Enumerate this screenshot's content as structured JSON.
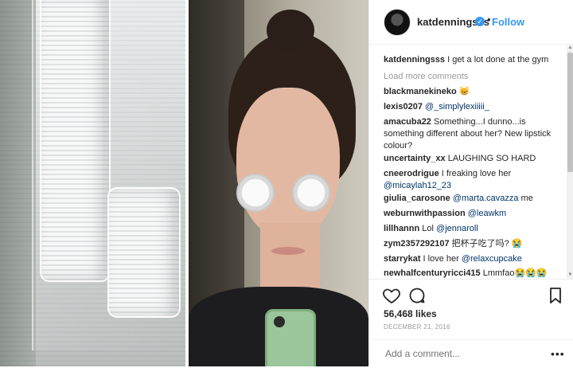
{
  "post": {
    "username": "katdenningsss",
    "verified_mark": "✓",
    "separator": "•",
    "follow_label": "Follow",
    "load_more": "Load more comments",
    "likes": "56,468 likes",
    "date": "DECEMBER 21, 2016",
    "add_comment_placeholder": "Add a comment...",
    "more_options": "•••"
  },
  "comments": [
    {
      "user": "katdenningsss",
      "text": " I get a lot done at the gym",
      "mention": ""
    },
    {
      "user": "blackmanekineko",
      "text": " 😸",
      "mention": ""
    },
    {
      "user": "lexis0207",
      "text": " ",
      "mention": "@_simplylexiiiii_"
    },
    {
      "user": "amacuba22",
      "text": " Something...I dunno...is something different about her? New lipstick colour?",
      "mention": ""
    },
    {
      "user": "uncertainty_xx",
      "text": " LAUGHING SO HARD",
      "mention": ""
    },
    {
      "user": "cneerodrigue",
      "text": " I freaking love her ",
      "mention": "@micaylah12_23"
    },
    {
      "user": "giulia_carosone",
      "text": " ",
      "mention": "@marta.cavazza",
      "after": " me"
    },
    {
      "user": "weburnwithpassion",
      "text": " ",
      "mention": "@leawkm"
    },
    {
      "user": "lillhannn",
      "text": " Lol ",
      "mention": "@jennaroll"
    },
    {
      "user": "zym2357292107",
      "text": " 把杯子吃了吗? 😭",
      "mention": ""
    },
    {
      "user": "starrykat",
      "text": " I love her ",
      "mention": "@relaxcupcake"
    },
    {
      "user": "newhalfcenturyricci415",
      "text": " Lmmfao😭😭😭",
      "mention": ""
    }
  ],
  "icons": {
    "heart": "heart-icon",
    "comment": "comment-icon",
    "bookmark": "bookmark-icon",
    "verified": "verified-badge-icon",
    "more": "more-options-icon"
  },
  "colors": {
    "accent": "#3897f0",
    "text": "#262626",
    "muted": "#999999",
    "mention": "#003569"
  }
}
